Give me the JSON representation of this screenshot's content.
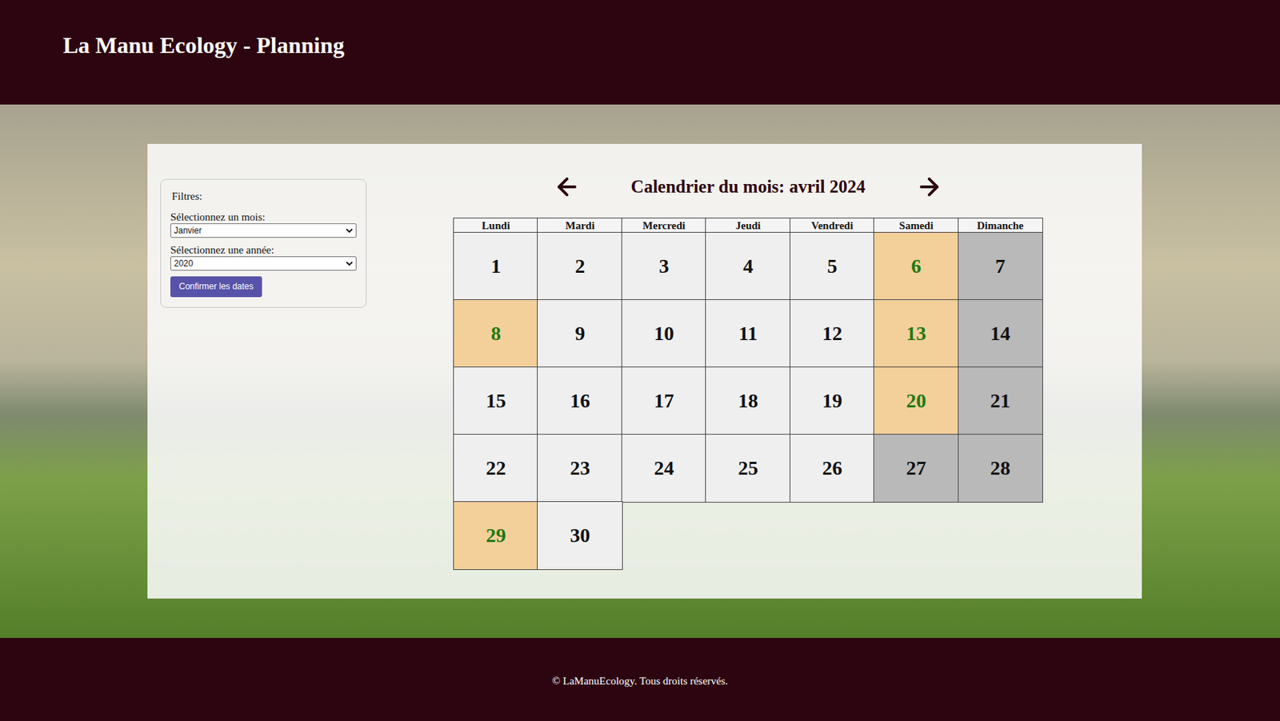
{
  "header": {
    "title": "La Manu Ecology - Planning"
  },
  "filters": {
    "title": "Filtres:",
    "month_label": "Sélectionnez un mois:",
    "month_value": "Janvier",
    "year_label": "Sélectionnez une année:",
    "year_value": "2020",
    "button": "Confirmer les dates"
  },
  "calendar": {
    "title": "Calendrier du mois: avril 2024",
    "weekdays": [
      "Lundi",
      "Mardi",
      "Mercredi",
      "Jeudi",
      "Vendredi",
      "Samedi",
      "Dimanche"
    ],
    "days": [
      {
        "label": "1",
        "kind": "open"
      },
      {
        "label": "2",
        "kind": "open"
      },
      {
        "label": "3",
        "kind": "open"
      },
      {
        "label": "4",
        "kind": "open"
      },
      {
        "label": "5",
        "kind": "open"
      },
      {
        "label": "6",
        "kind": "booked"
      },
      {
        "label": "7",
        "kind": "closed"
      },
      {
        "label": "8",
        "kind": "booked"
      },
      {
        "label": "9",
        "kind": "open"
      },
      {
        "label": "10",
        "kind": "open"
      },
      {
        "label": "11",
        "kind": "open"
      },
      {
        "label": "12",
        "kind": "open"
      },
      {
        "label": "13",
        "kind": "booked"
      },
      {
        "label": "14",
        "kind": "closed"
      },
      {
        "label": "15",
        "kind": "open"
      },
      {
        "label": "16",
        "kind": "open"
      },
      {
        "label": "17",
        "kind": "open"
      },
      {
        "label": "18",
        "kind": "open"
      },
      {
        "label": "19",
        "kind": "open"
      },
      {
        "label": "20",
        "kind": "booked"
      },
      {
        "label": "21",
        "kind": "closed"
      },
      {
        "label": "22",
        "kind": "open"
      },
      {
        "label": "23",
        "kind": "open"
      },
      {
        "label": "24",
        "kind": "open"
      },
      {
        "label": "25",
        "kind": "open"
      },
      {
        "label": "26",
        "kind": "open"
      },
      {
        "label": "27",
        "kind": "closed"
      },
      {
        "label": "28",
        "kind": "closed"
      },
      {
        "label": "29",
        "kind": "booked"
      },
      {
        "label": "30",
        "kind": "open"
      }
    ]
  },
  "footer": {
    "text": "© LaManuEcology. Tous droits réservés."
  }
}
